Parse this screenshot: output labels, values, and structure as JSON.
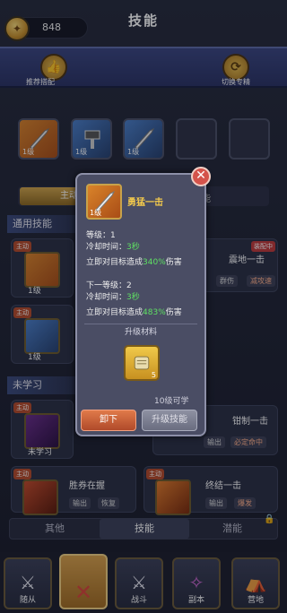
{
  "currency": {
    "value": "848"
  },
  "header": {
    "title": "技能",
    "left_label": "推荐搭配",
    "right_label": "切换专精"
  },
  "equipped_slots": [
    {
      "level": "1级"
    },
    {
      "level": "1级"
    },
    {
      "level": "1级"
    }
  ],
  "type_tabs": {
    "left": "主动",
    "right": "技能"
  },
  "section_common": "通用技能",
  "section_unlearned": "未学习",
  "left_cards": [
    {
      "tag": "主动",
      "level": "1级"
    },
    {
      "tag": "主动",
      "level": "1级"
    },
    {
      "tag": "主动",
      "level": "未学习"
    },
    {
      "tag": "主动",
      "name": "胜券在握",
      "chip1": "输出",
      "chip2": "恢复"
    }
  ],
  "right_cards": [
    {
      "name": "震地一击",
      "tag": "装配中",
      "chip1": "群伤",
      "chip2": "减攻速"
    },
    {
      "name": "钳制一击",
      "chip1": "输出",
      "chip2": "必定命中"
    },
    {
      "tag": "主动",
      "name": "终结一击",
      "chip1": "输出",
      "chip2": "爆发"
    }
  ],
  "bottom_tabs": {
    "other": "其他",
    "skill": "技能",
    "potential": "潜能"
  },
  "nav": [
    {
      "label": "随从"
    },
    {
      "label": ""
    },
    {
      "label": "战斗"
    },
    {
      "label": "副本"
    },
    {
      "label": "营地"
    }
  ],
  "popup": {
    "skill_name": "勇猛一击",
    "skill_level": "1级",
    "level_line": "等级：1",
    "cd_label": "冷却时间：",
    "cd_value": "3秒",
    "effect_pre": "立即对目标造成",
    "effect_value": "340%",
    "effect_post": "伤害",
    "next_level_line": "下一等级：2",
    "next_cd_label": "冷却时间：",
    "next_cd_value": "3秒",
    "next_effect_pre": "立即对目标造成",
    "next_effect_value": "483%",
    "next_effect_post": "伤害",
    "materials_title": "升级材料",
    "material_count": "5",
    "level_req": "10级可学",
    "unequip_label": "卸下",
    "upgrade_label": "升级技能"
  }
}
